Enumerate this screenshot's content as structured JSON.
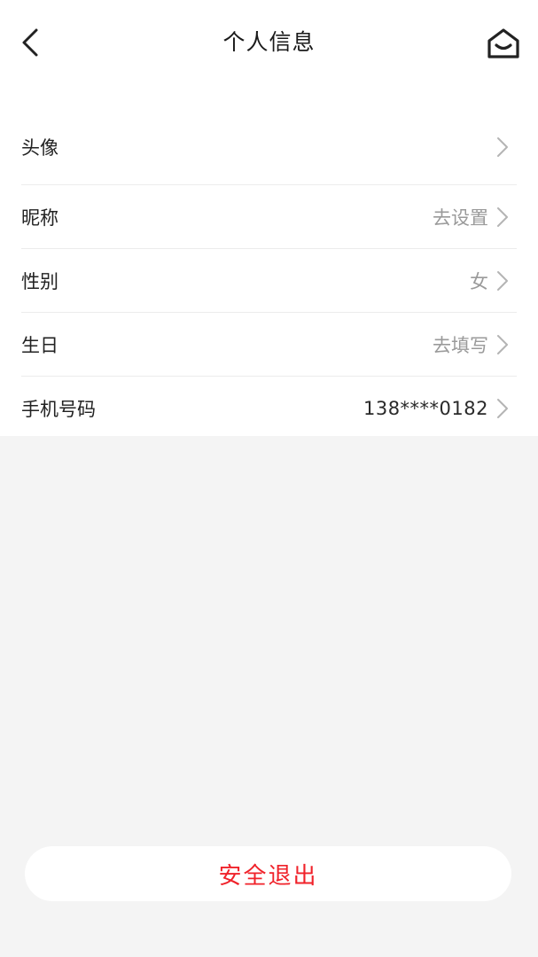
{
  "header": {
    "title": "个人信息",
    "back_icon": "chevron-left-icon",
    "home_icon": "home-icon"
  },
  "rows": [
    {
      "label": "头像",
      "value": ""
    },
    {
      "label": "昵称",
      "value": "去设置"
    },
    {
      "label": "性别",
      "value": "女"
    },
    {
      "label": "生日",
      "value": "去填写"
    },
    {
      "label": "手机号码",
      "value": "138****0182"
    }
  ],
  "logout": {
    "label": "安全退出"
  },
  "colors": {
    "accent": "#f0222a",
    "background": "#f4f4f4",
    "placeholder": "#9a9a9a"
  }
}
